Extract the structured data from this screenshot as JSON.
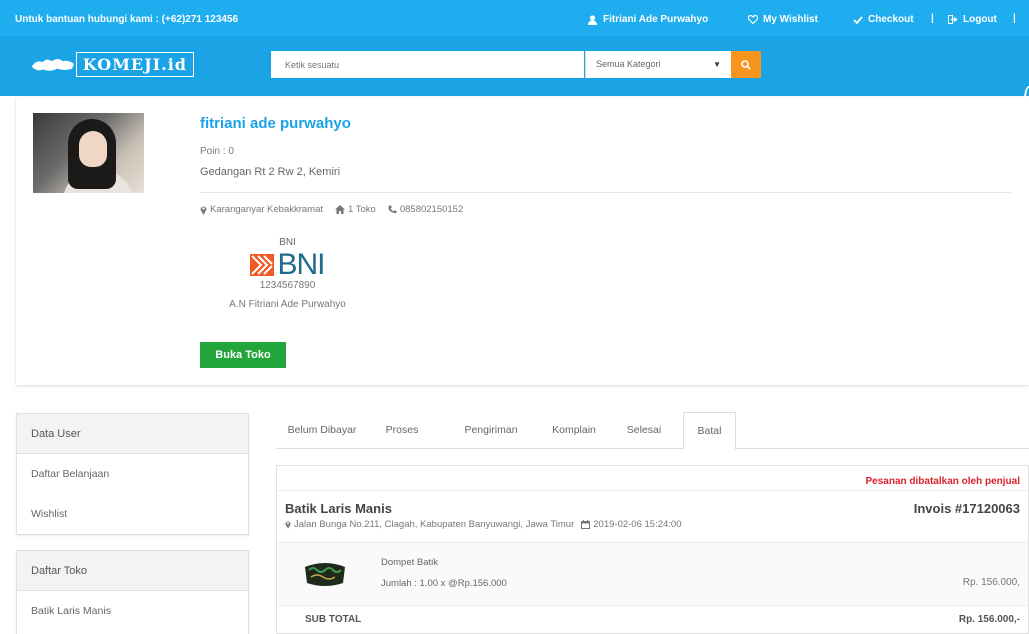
{
  "topbar": {
    "help_text": "Untuk bantuan hubungi kami : (+62)271 123456",
    "user_name": "Fitriani Ade Purwahyo",
    "wishlist_label": "My Wishlist",
    "checkout_label": "Checkout",
    "separator": "|",
    "logout_label": "Logout",
    "bg_color": "#1eaef0"
  },
  "navbar": {
    "logo_text": "KOMEJI.id",
    "search_placeholder": "Ketik sesuatu",
    "category_selected": "Semua Kategori",
    "search_button_color": "#f7941d"
  },
  "profile": {
    "name": "fitriani ade purwahyo",
    "poin": "Poin : 0",
    "address": "Gedangan Rt 2 Rw 2, Kemiri",
    "location": "Karanganyar Kebakkramat",
    "toko_count": "1 Toko",
    "phone": "085802150152",
    "bank": {
      "name": "BNI",
      "logo_text": "BNI",
      "account_number": "1234567890",
      "account_owner": "A.N Fitriani Ade Purwahyo"
    },
    "buka_toko_label": "Buka Toko"
  },
  "sidebar": {
    "data_user": {
      "heading": "Data User",
      "items": [
        {
          "label": "Daftar Belanjaan"
        },
        {
          "label": "Wishlist"
        }
      ]
    },
    "daftar_toko": {
      "heading": "Daftar Toko",
      "items": [
        {
          "label": "Batik Laris Manis"
        }
      ]
    }
  },
  "tabs": [
    {
      "label": "Belum Dibayar",
      "active": false
    },
    {
      "label": "Proses",
      "active": false
    },
    {
      "label": "Pengiriman",
      "active": false
    },
    {
      "label": "Komplain",
      "active": false
    },
    {
      "label": "Selesai",
      "active": false
    },
    {
      "label": "Batal",
      "active": true
    }
  ],
  "order": {
    "status": "Pesanan dibatalkan oleh penjual",
    "shop_name": "Batik Laris Manis",
    "invoice": "Invois #17120063",
    "address": "Jalan Bunga No.211, Clagah, Kabupaten Banyuwangi, Jawa Timur",
    "datetime": "2019-02-06 15:24:00",
    "product_name": "Dompet Batik",
    "product_qty": "Jumlah : 1.00 x @Rp.156.000",
    "product_price": "Rp. 156.000,",
    "subtotal_label": "SUB TOTAL",
    "subtotal_value": "Rp. 156.000,-",
    "status_color": "#d9232d"
  }
}
